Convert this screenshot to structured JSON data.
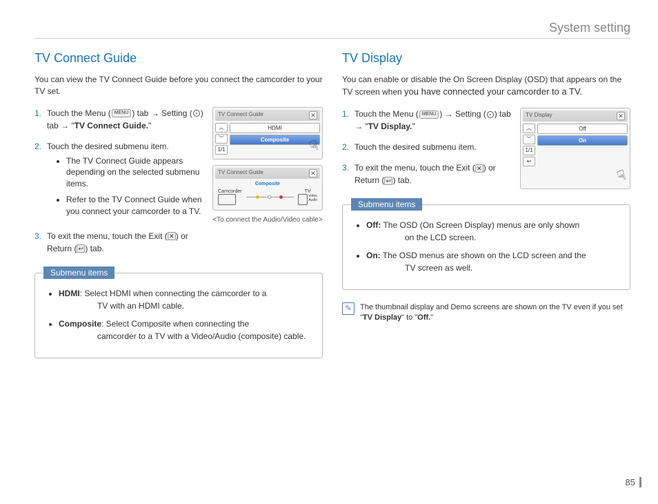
{
  "header": "System setting",
  "page_number": "85",
  "left": {
    "title": "TV Connect Guide",
    "intro": "You can view the TV Connect Guide before you connect the camcorder to your TV set.",
    "steps": [
      {
        "num": "1.",
        "pre": "Touch the Menu (",
        "menu_label": "MENU",
        "mid1": ") tab → Setting (",
        "mid2": ") tab → \"",
        "bold": "TV Connect Guide.",
        "post": "\""
      },
      {
        "num": "2.",
        "text": "Touch the desired submenu item.",
        "bullets": [
          "The TV Connect Guide appears depending on the selected submenu items.",
          "Refer to the TV Connect Guide when you connect your camcorder to a TV."
        ]
      },
      {
        "num": "3.",
        "pre": "To exit the menu, touch the Exit (",
        "x": "✕",
        "mid": ") or Return (",
        "ret": "↩",
        "post": ") tab."
      }
    ],
    "screenshot1": {
      "title": "TV Connect Guide",
      "items": [
        "HDMI",
        "Composite"
      ]
    },
    "screenshot2": {
      "title": "TV Connect Guide",
      "label": "Composite",
      "camcorder": "Camcorder",
      "tv": "TV",
      "video": "Video",
      "audio": "Audio"
    },
    "caption": "<To connect the Audio/Video cable>",
    "submenu": {
      "tag": "Submenu items",
      "items": [
        {
          "b": "HDMI",
          "t1": ": Select HDMI when connecting the camcorder to a",
          "t2": "TV with an HDMI cable."
        },
        {
          "b": "Composite",
          "t1": ": Select Composite when connecting the",
          "t2": "camcorder to a TV with a Video/Audio (composite) cable."
        }
      ]
    }
  },
  "right": {
    "title": "TV Display",
    "intro_a": "You can enable or disable the On Screen Display (OSD) that appears on the TV screen when ",
    "intro_b": "you have connected your camcorder to a TV.",
    "steps": [
      {
        "num": "1.",
        "pre": "Touch the Menu (",
        "menu_label": "MENU",
        "mid1": ") → Setting (",
        "mid2": ") tab → \"",
        "bold": "TV Display.",
        "post": "\""
      },
      {
        "num": "2.",
        "text": "Touch the desired submenu item."
      },
      {
        "num": "3.",
        "pre": "To exit the menu, touch the Exit (",
        "x": "✕",
        "mid": ") or Return (",
        "ret": "↩",
        "post": ") tab."
      }
    ],
    "screenshot": {
      "title": "TV Display",
      "items": [
        "Off",
        "On"
      ]
    },
    "submenu": {
      "tag": "Submenu items",
      "items": [
        {
          "b": "Off:",
          "t1": " The OSD (On Screen Display) menus are only shown",
          "t2": "on the LCD screen."
        },
        {
          "b": "On:",
          "t1": " The OSD menus are shown on the LCD screen and the",
          "t2": "TV screen as well."
        }
      ]
    },
    "note": {
      "icon": "✎",
      "text_a": "The thumbnail display and Demo screens are shown on the TV even if you set \"",
      "b1": "TV Display",
      "mid": "\" to \"",
      "b2": "Off.",
      "post": "\""
    }
  }
}
